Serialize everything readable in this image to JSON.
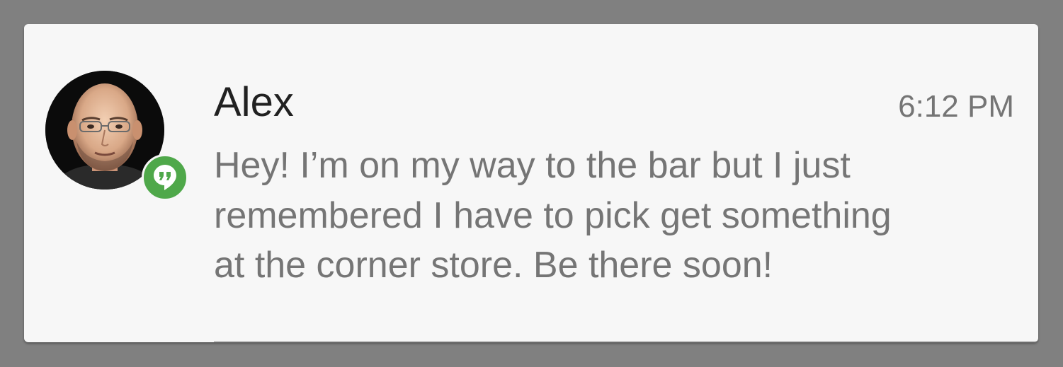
{
  "notification": {
    "sender": "Alex",
    "time": "6:12 PM",
    "message_lines": [
      "Hey! I’m on my way to the bar but I just",
      "remembered I have to pick get something",
      "at the corner store. Be there soon!"
    ],
    "avatar": "contact-photo",
    "app_icon": "hangouts-quote-icon",
    "app_icon_color": "#4fa84a"
  },
  "colors": {
    "backdrop": "#808080",
    "card": "#f7f7f7",
    "title_text": "#212121",
    "body_text": "#757575"
  }
}
